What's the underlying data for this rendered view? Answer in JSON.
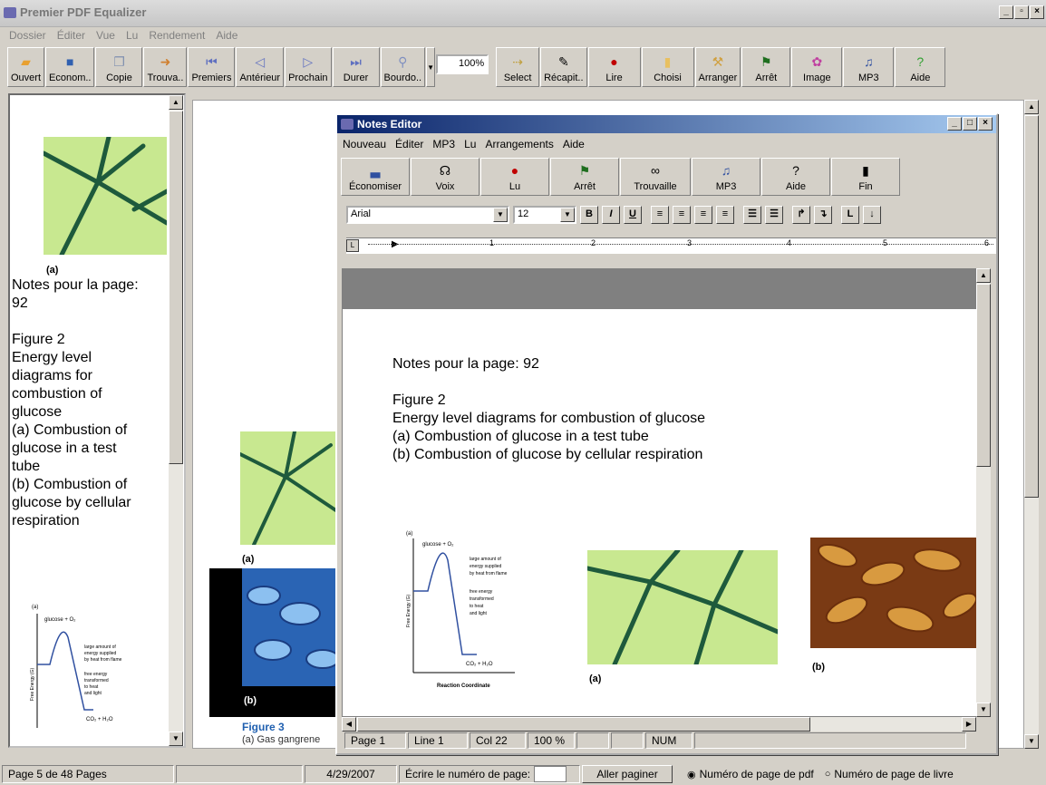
{
  "app": {
    "title": "Premier PDF Equalizer"
  },
  "menu": [
    "Dossier",
    "Éditer",
    "Vue",
    "Lu",
    "Rendement",
    "Aide"
  ],
  "toolbar": [
    {
      "label": "Ouvert",
      "icon": "folder-icon"
    },
    {
      "label": "Econom..",
      "icon": "save-icon"
    },
    {
      "label": "Copie",
      "icon": "copy-icon"
    },
    {
      "label": "Trouva..",
      "icon": "find-icon"
    },
    {
      "label": "Premiers",
      "icon": "first-page-icon"
    },
    {
      "label": "Antérieur",
      "icon": "previous-icon"
    },
    {
      "label": "Prochain",
      "icon": "next-icon"
    },
    {
      "label": "Durer",
      "icon": "last-page-icon"
    },
    {
      "label": "Bourdo..",
      "icon": "zoom-icon"
    },
    {
      "label": "Select",
      "icon": "select-icon"
    },
    {
      "label": "Récapit..",
      "icon": "summary-icon"
    },
    {
      "label": "Lire",
      "icon": "read-icon"
    },
    {
      "label": "Choisi",
      "icon": "choose-icon"
    },
    {
      "label": "Arranger",
      "icon": "arrange-icon"
    },
    {
      "label": "Arrêt",
      "icon": "stop-icon"
    },
    {
      "label": "Image",
      "icon": "image-icon"
    },
    {
      "label": "MP3",
      "icon": "mp3-icon"
    },
    {
      "label": "Aide",
      "icon": "help-icon"
    }
  ],
  "zoom": "100%",
  "left_pane": {
    "caption": "(a)",
    "text": [
      "Notes pour la page:",
      "92",
      "",
      "Figure 2",
      "Energy level",
      "diagrams for",
      "combustion of",
      "glucose",
      "(a) Combustion of",
      "glucose in a test",
      "tube",
      "(b) Combustion of",
      "glucose by cellular",
      "respiration"
    ]
  },
  "main_page": {
    "caption_a": "(a)",
    "caption_b": "(b)",
    "figure_label": "Figure 3",
    "figure_text": "(a) Gas gangrene"
  },
  "notes_editor": {
    "title": "Notes Editor",
    "menu": [
      "Nouveau",
      "Éditer",
      "MP3",
      "Lu",
      "Arrangements",
      "Aide"
    ],
    "toolbar": [
      {
        "label": "Économiser",
        "icon": "save-icon"
      },
      {
        "label": "Voix",
        "icon": "voice-icon"
      },
      {
        "label": "Lu",
        "icon": "read-icon"
      },
      {
        "label": "Arrêt",
        "icon": "stop-icon"
      },
      {
        "label": "Trouvaille",
        "icon": "binoculars-icon"
      },
      {
        "label": "MP3",
        "icon": "mp3-icon"
      },
      {
        "label": "Aide",
        "icon": "help-icon"
      },
      {
        "label": "Fin",
        "icon": "exit-icon"
      }
    ],
    "font": "Arial",
    "size": "12",
    "ruler_marks": [
      "1",
      "2",
      "3",
      "4",
      "5",
      "6"
    ],
    "doc_text": [
      "Notes pour la page: 92",
      "",
      "Figure 2",
      "Energy level diagrams for combustion of glucose",
      "(a) Combustion of glucose in a test tube",
      "(b) Combustion of glucose by cellular respiration"
    ],
    "caption_a": "(a)",
    "caption_b": "(b)",
    "status": {
      "page": "Page 1",
      "line": "Line 1",
      "col": "Col 22",
      "zoom": "100 %",
      "num": "NUM"
    }
  },
  "diagram": {
    "label": "(a)",
    "top_label": "glucose + O₂",
    "annotation_1": [
      "large amount of",
      "energy supplied",
      "by heat from flame"
    ],
    "annotation_2": [
      "free energy",
      "transformed",
      "to heat",
      "and light"
    ],
    "product": "CO₂ + H₂O",
    "y_axis": "Free Energy (G)",
    "x_axis": "Reaction Coordinate"
  },
  "statusbar": {
    "pages": "Page 5 de 48 Pages",
    "date": "4/29/2007",
    "enter_label": "Écrire le numéro de page:",
    "go_button": "Aller paginer",
    "radio_1": "Numéro de page de pdf",
    "radio_2": "Numéro de page de livre"
  },
  "colors": {
    "titlebar_active": "#0a246a",
    "bacteria_green": "#c8e890",
    "bacteria_dark": "#1e5a3c",
    "bacteria_blue": "#2a64b4",
    "bacteria_orange": "#c8781e"
  }
}
